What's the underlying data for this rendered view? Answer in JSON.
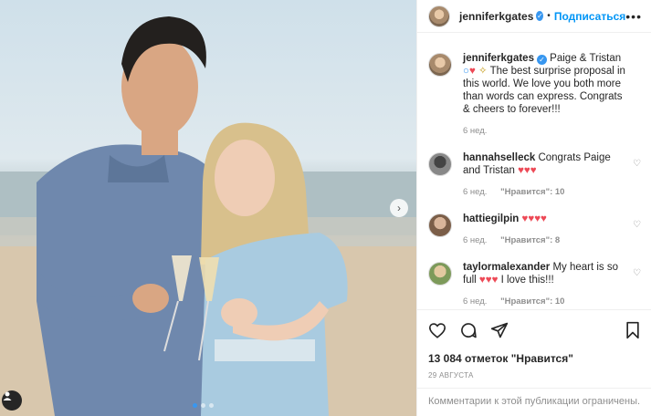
{
  "header": {
    "username": "jenniferkgates",
    "separator": "•",
    "follow_label": "Подписаться",
    "more": "•••"
  },
  "caption": {
    "username": "jenniferkgates",
    "text_start": " Paige & Tristan ",
    "text_end": " The best surprise proposal in this world. We love you both more than words can express. Congrats & cheers to forever!!!",
    "time": "6 нед."
  },
  "comments": [
    {
      "username": "hannahselleck",
      "text": " Congrats Paige and Tristan ",
      "hearts": "♥♥♥",
      "time": "6 нед.",
      "likes": "\"Нравится\": 10"
    },
    {
      "username": "hattiegilpin",
      "text": " ",
      "hearts": "♥♥♥♥",
      "time": "6 нед.",
      "likes": "\"Нравится\": 8"
    },
    {
      "username": "taylormalexander",
      "text": " My heart is so full ",
      "hearts": "♥♥♥",
      "text2": " I love this!!!",
      "time": "6 нед.",
      "likes": "\"Нравится\": 10"
    }
  ],
  "actions": {
    "likes_count": "13 084 отметок \"Нравится\"",
    "date": "29 АВГУСТА"
  },
  "footer": {
    "comments_limited": "Комментарии к этой публикации ограничены."
  },
  "carousel": {
    "total": 3,
    "current": 1
  },
  "colors": {
    "accent": "#0095f6",
    "heart": "#ed4956",
    "muted": "#8e8e8e",
    "verified": "#3897f0"
  }
}
